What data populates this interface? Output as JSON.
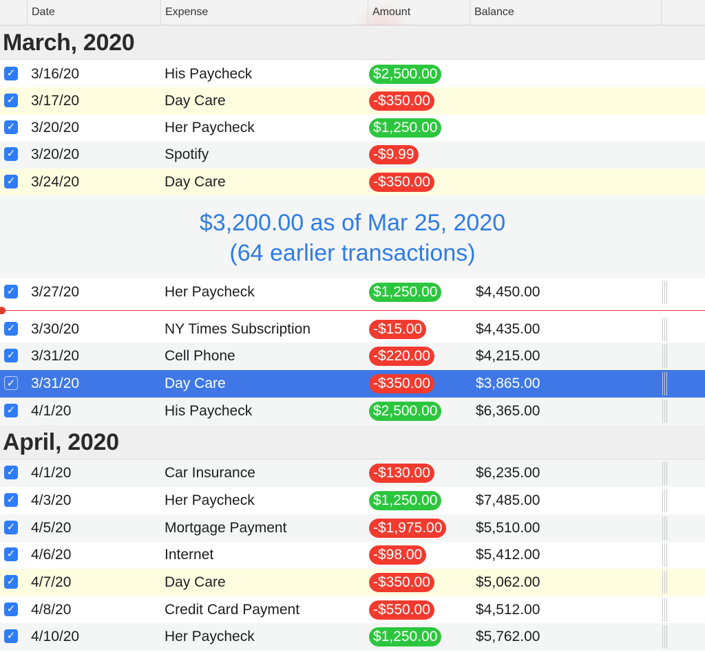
{
  "columns": {
    "date": "Date",
    "expense": "Expense",
    "amount": "Amount",
    "balance": "Balance"
  },
  "months": {
    "march": "March, 2020",
    "april": "April, 2020"
  },
  "summary": {
    "line1": "$3,200.00 as of Mar 25, 2020",
    "line2": "(64 earlier transactions)"
  },
  "check_glyph": "✓",
  "rows": [
    {
      "date": "3/16/20",
      "expense": "His Paycheck",
      "amount": "$2,500.00",
      "balance": ""
    },
    {
      "date": "3/17/20",
      "expense": "Day Care",
      "amount": "-$350.00",
      "balance": ""
    },
    {
      "date": "3/20/20",
      "expense": "Her Paycheck",
      "amount": "$1,250.00",
      "balance": ""
    },
    {
      "date": "3/20/20",
      "expense": "Spotify",
      "amount": "-$9.99",
      "balance": ""
    },
    {
      "date": "3/24/20",
      "expense": "Day Care",
      "amount": "-$350.00",
      "balance": ""
    },
    {
      "date": "3/27/20",
      "expense": "Her Paycheck",
      "amount": "$1,250.00",
      "balance": "$4,450.00"
    },
    {
      "date": "3/30/20",
      "expense": "NY Times Subscription",
      "amount": "-$15.00",
      "balance": "$4,435.00"
    },
    {
      "date": "3/31/20",
      "expense": "Cell Phone",
      "amount": "-$220.00",
      "balance": "$4,215.00"
    },
    {
      "date": "3/31/20",
      "expense": "Day Care",
      "amount": "-$350.00",
      "balance": "$3,865.00"
    },
    {
      "date": "4/1/20",
      "expense": "His Paycheck",
      "amount": "$2,500.00",
      "balance": "$6,365.00"
    },
    {
      "date": "4/1/20",
      "expense": "Car Insurance",
      "amount": "-$130.00",
      "balance": "$6,235.00"
    },
    {
      "date": "4/3/20",
      "expense": "Her Paycheck",
      "amount": "$1,250.00",
      "balance": "$7,485.00"
    },
    {
      "date": "4/5/20",
      "expense": "Mortgage Payment",
      "amount": "-$1,975.00",
      "balance": "$5,510.00"
    },
    {
      "date": "4/6/20",
      "expense": "Internet",
      "amount": "-$98.00",
      "balance": "$5,412.00"
    },
    {
      "date": "4/7/20",
      "expense": "Day Care",
      "amount": "-$350.00",
      "balance": "$5,062.00"
    },
    {
      "date": "4/8/20",
      "expense": "Credit Card Payment",
      "amount": "-$550.00",
      "balance": "$4,512.00"
    },
    {
      "date": "4/10/20",
      "expense": "Her Paycheck",
      "amount": "$1,250.00",
      "balance": "$5,762.00"
    }
  ],
  "colors": {
    "positive": "#2cc63e",
    "negative": "#f23a2e",
    "selected": "#3f78e6",
    "highlight": "#fffde0",
    "summary_text": "#2f7ce4",
    "today_line": "#e0392f"
  }
}
